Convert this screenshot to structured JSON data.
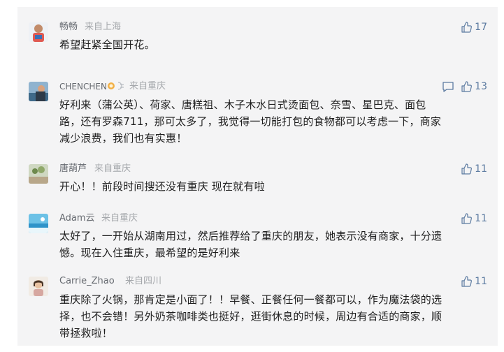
{
  "comments": [
    {
      "name": "畅畅",
      "location": "来自上海",
      "likes": "17",
      "text": "希望赶紧全国开花。"
    },
    {
      "name": "CHENCHEN",
      "location": "来自重庆",
      "likes": "13",
      "text_lines": [
        "好利来（蒲公英）、荷家、唐糕祖、木子木水日式烫面包、奈雪、星巴克、面包",
        "路，还有罗森711，那可太多了，我觉得一切能打包的食物都可以考虑一下，商家",
        "减少浪费，我们也有实惠！"
      ]
    },
    {
      "name": "唐葫芦",
      "location": "来自重庆",
      "likes": "11",
      "text": "开心！！前段时间搜还没有重庆 现在就有啦"
    },
    {
      "name": "Adam云",
      "location": "来自重庆",
      "likes": "11",
      "text_lines": [
        "太好了，一开始从湖南用过，然后推荐给了重庆的朋友，她表示没有商家，十分遗",
        "憾。现在入住重庆，最希望的是好利来"
      ]
    },
    {
      "name": "Carrie_Zhao",
      "location": "来自四川",
      "likes": "11",
      "text_lines": [
        "重庆除了火锅，那肯定是小面了！！早餐、正餐任何一餐都可以，作为魔法袋的选",
        "择，也不会错！另外奶茶咖啡类也挺好，逛街休息的时候，周边有合适的商家，顺",
        "带拯救啦！"
      ]
    }
  ],
  "colors": {
    "panel_bg": "#f4f4f5",
    "name": "#666a70",
    "location": "#a4a7ab",
    "text": "#1e1e1e",
    "like": "#5b7aa0"
  },
  "icons": {
    "like": "thumbs-up-icon",
    "reply": "comment-bubble-icon"
  }
}
